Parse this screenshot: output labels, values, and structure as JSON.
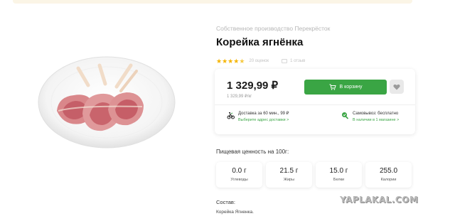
{
  "brand": "Собственное производство Перекрёсток",
  "product": {
    "title": "Корейка ягнёнка",
    "rating_value": 4.5,
    "reviews_count": "20 оценок",
    "reviews_link": "1 отзыв"
  },
  "price_card": {
    "price": "1 329,99 ₽",
    "unit_price": "1 329,99 ₽/кг",
    "cart_label": "В корзину",
    "delivery_main": "Доставка за 60 мин., 99 ₽",
    "delivery_link": "Выберите адрес доставки >",
    "pickup_main": "Самовывоз: бесплатно",
    "pickup_link": "В наличии в 1 магазине >"
  },
  "nutrition": {
    "title": "Пищевая ценность на 100г:",
    "items": [
      {
        "value": "0.0 г",
        "label": "Углеводы"
      },
      {
        "value": "21.5 г",
        "label": "Жиры"
      },
      {
        "value": "15.0 г",
        "label": "Белки"
      },
      {
        "value": "255.0",
        "label": "Калории"
      }
    ]
  },
  "composition": {
    "title": "Состав:",
    "text": "Корейка Ягненка."
  },
  "watermark": "YAPLAKAL.COM",
  "colors": {
    "accent_green": "#3aa544",
    "star_yellow": "#f5b400"
  },
  "icons": [
    "star-icon",
    "comment-icon",
    "cart-icon",
    "heart-icon",
    "delivery-icon",
    "pickup-icon"
  ]
}
